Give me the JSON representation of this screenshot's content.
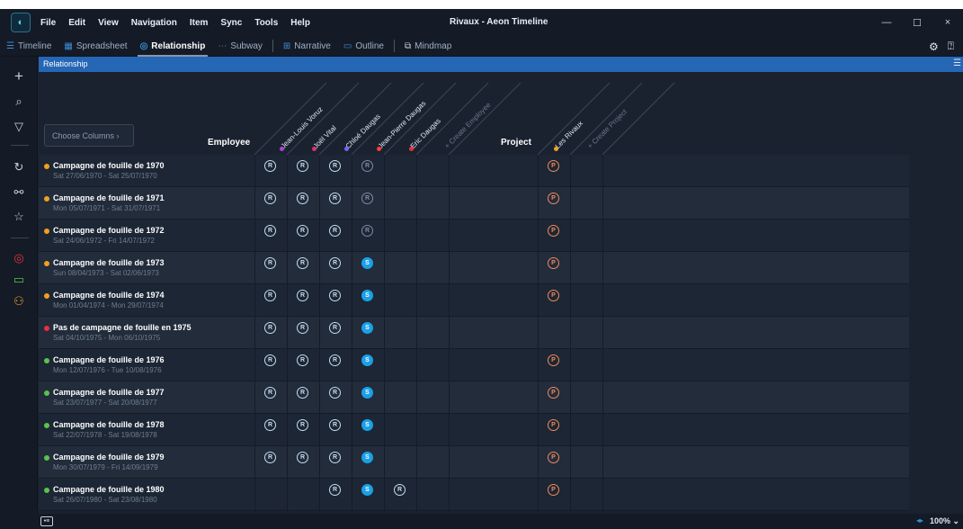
{
  "app": {
    "title": "Rivaux - Aeon Timeline"
  },
  "menu": [
    "File",
    "Edit",
    "View",
    "Navigation",
    "Item",
    "Sync",
    "Tools",
    "Help"
  ],
  "window_controls": {
    "minimize": "—",
    "maximize": "☐",
    "close": "×"
  },
  "toolbar": {
    "timeline": "Timeline",
    "spreadsheet": "Spreadsheet",
    "relationship": "Relationship",
    "subway": "Subway",
    "narrative": "Narrative",
    "outline": "Outline",
    "mindmap": "Mindmap"
  },
  "panel": {
    "title": "Relationship"
  },
  "columns": {
    "choose_label": "Choose Columns  ›",
    "employee_group": "Employee",
    "project_group": "Project",
    "employees": [
      {
        "name": "Jean-Louis Voruz",
        "color": "#b33fd6"
      },
      {
        "name": "Joël Vital",
        "color": "#e0306a"
      },
      {
        "name": "Chloé Daugas",
        "color": "#7a5cff"
      },
      {
        "name": "Jean-Pierre Daugas",
        "color": "#ff3b3b"
      },
      {
        "name": "Eric Daugas",
        "color": "#e8303c"
      }
    ],
    "create_employee": "+ Create Employee",
    "projects": [
      {
        "name": "Les Rivaux",
        "color": "#f0a020"
      }
    ],
    "create_project": "+ Create Project"
  },
  "rows": [
    {
      "name": "Campagne de fouille de 1970",
      "dates": "Sat 27/06/1970 - Sat 25/07/1970",
      "color": "#f0a020",
      "cells": [
        "R",
        "R",
        "R",
        "Rg",
        "",
        ""
      ],
      "project": "P"
    },
    {
      "name": "Campagne de fouille de 1971",
      "dates": "Mon 05/07/1971 - Sat 31/07/1971",
      "color": "#f0a020",
      "cells": [
        "R",
        "R",
        "R",
        "Rg",
        "",
        ""
      ],
      "project": "P"
    },
    {
      "name": "Campagne de fouille de 1972",
      "dates": "Sat 24/06/1972 - Fri 14/07/1972",
      "color": "#f0a020",
      "cells": [
        "R",
        "R",
        "R",
        "Rg",
        "",
        ""
      ],
      "project": "P"
    },
    {
      "name": "Campagne de fouille de 1973",
      "dates": "Sun 08/04/1973 - Sat 02/06/1973",
      "color": "#f0a020",
      "cells": [
        "R",
        "R",
        "R",
        "S",
        "",
        ""
      ],
      "project": "P"
    },
    {
      "name": "Campagne de fouille de 1974",
      "dates": "Mon 01/04/1974 - Mon 29/07/1974",
      "color": "#f0a020",
      "cells": [
        "R",
        "R",
        "R",
        "S",
        "",
        ""
      ],
      "project": "P"
    },
    {
      "name": "Pas de campagne de fouille en 1975",
      "dates": "Sat 04/10/1975 - Mon 06/10/1975",
      "color": "#e8303c",
      "cells": [
        "R",
        "R",
        "R",
        "S",
        "",
        ""
      ],
      "project": ""
    },
    {
      "name": "Campagne de fouille de 1976",
      "dates": "Mon 12/07/1976 - Tue 10/08/1976",
      "color": "#5cc24a",
      "cells": [
        "R",
        "R",
        "R",
        "S",
        "",
        ""
      ],
      "project": "P"
    },
    {
      "name": "Campagne de fouille de 1977",
      "dates": "Sat 23/07/1977 - Sat 20/08/1977",
      "color": "#5cc24a",
      "cells": [
        "R",
        "R",
        "R",
        "S",
        "",
        ""
      ],
      "project": "P"
    },
    {
      "name": "Campagne de fouille de 1978",
      "dates": "Sat 22/07/1978 - Sat 19/08/1978",
      "color": "#5cc24a",
      "cells": [
        "R",
        "R",
        "R",
        "S",
        "",
        ""
      ],
      "project": "P"
    },
    {
      "name": "Campagne de fouille de 1979",
      "dates": "Mon 30/07/1979 - Fri 14/09/1979",
      "color": "#5cc24a",
      "cells": [
        "R",
        "R",
        "R",
        "S",
        "",
        ""
      ],
      "project": "P"
    },
    {
      "name": "Campagne de fouille de 1980",
      "dates": "Sat 26/07/1980 - Sat 23/08/1980",
      "color": "#5cc24a",
      "cells": [
        "",
        "",
        "R",
        "S",
        "R",
        ""
      ],
      "project": "P"
    }
  ],
  "status": {
    "zoom": "100% ⌄"
  }
}
